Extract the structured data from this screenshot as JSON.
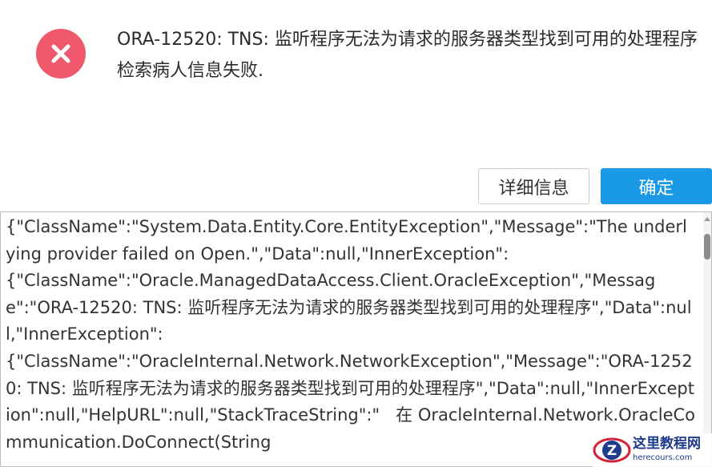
{
  "dialog": {
    "message": "ORA-12520: TNS: 监听程序无法为请求的服务器类型找到可用的处理程序 检索病人信息失败.",
    "buttons": {
      "details_label": "详细信息",
      "ok_label": "确定"
    },
    "details_text": "{\"ClassName\":\"System.Data.Entity.Core.EntityException\",\"Message\":\"The underlying provider failed on Open.\",\"Data\":null,\"InnerException\":\n{\"ClassName\":\"Oracle.ManagedDataAccess.Client.OracleException\",\"Message\":\"ORA-12520: TNS: 监听程序无法为请求的服务器类型找到可用的处理程序\",\"Data\":null,\"InnerException\":\n{\"ClassName\":\"OracleInternal.Network.NetworkException\",\"Message\":\"ORA-12520: TNS: 监听程序无法为请求的服务器类型找到可用的处理程序\",\"Data\":null,\"InnerException\":null,\"HelpURL\":null,\"StackTraceString\":\"   在 OracleInternal.Network.OracleCommunication.DoConnect(String",
    "icon": "error-x-icon",
    "accent_color": "#1a9ae6",
    "error_color": "#f0596b"
  },
  "watermark": {
    "title": "这里教程网",
    "url": "herecours.com",
    "logo_letter": "Z"
  }
}
